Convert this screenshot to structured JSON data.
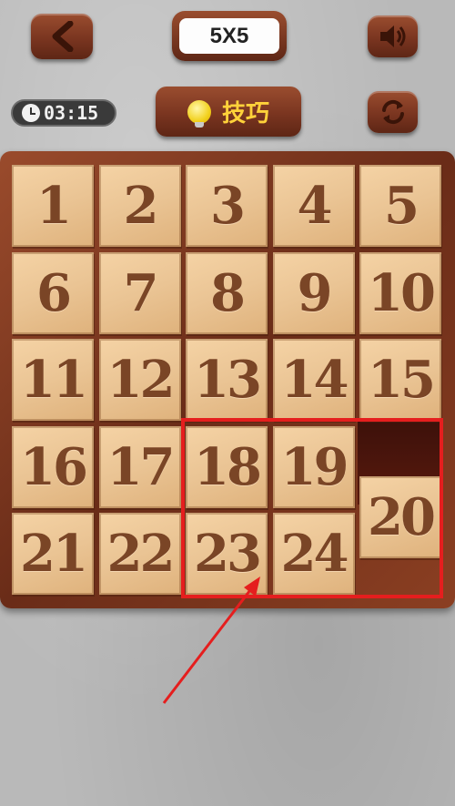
{
  "toolbar": {
    "back_icon": "chevron-left-icon",
    "level_label": "5X5",
    "sound_icon": "speaker-icon",
    "refresh_icon": "refresh-icon"
  },
  "timer": {
    "value": "03:15"
  },
  "hint": {
    "label": "技巧",
    "icon": "lightbulb-icon"
  },
  "board": {
    "size": "5X5",
    "tiles": [
      1,
      2,
      3,
      4,
      5,
      6,
      7,
      8,
      9,
      10,
      11,
      12,
      13,
      14,
      15,
      16,
      17,
      18,
      19,
      null,
      21,
      22,
      23,
      24,
      20
    ],
    "empty_cell": {
      "row": 4,
      "col": 5
    },
    "tile_20_position": "row 5, col 5"
  },
  "colors": {
    "wood_dark": "#7a3520",
    "tile": "#eac494",
    "tile_text": "#7a4526",
    "highlight": "#e51e1e",
    "hint_text": "#ffd23a"
  }
}
